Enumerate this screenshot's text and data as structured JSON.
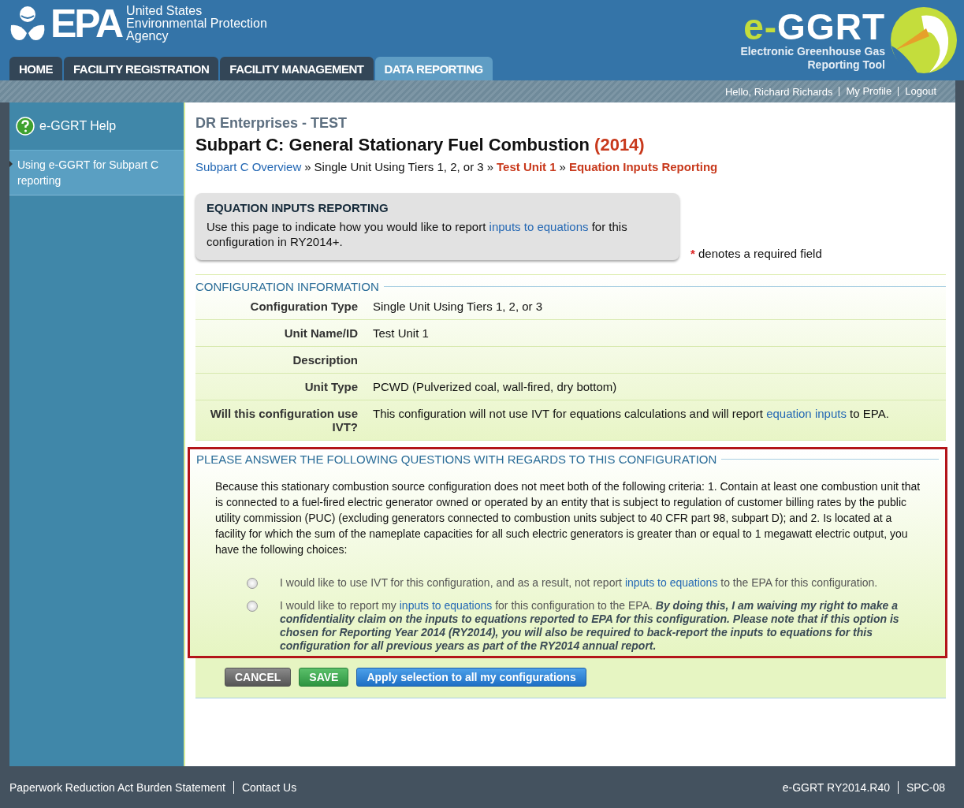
{
  "header": {
    "agency": [
      "United States",
      "Environmental Protection",
      "Agency"
    ],
    "logo_text": "EPA",
    "tool_logo": {
      "e": "e-",
      "ggrt": "GGRT",
      "subtitle": [
        "Electronic Greenhouse Gas",
        "Reporting Tool"
      ]
    }
  },
  "tabs": [
    {
      "label": "HOME",
      "selected": false
    },
    {
      "label": "FACILITY REGISTRATION",
      "selected": false
    },
    {
      "label": "FACILITY MANAGEMENT",
      "selected": false
    },
    {
      "label": "DATA REPORTING",
      "selected": true
    }
  ],
  "user_bar": {
    "greeting": "Hello, Richard Richards",
    "links": [
      "My Profile",
      "Logout"
    ]
  },
  "sidebar": {
    "title": "e-GGRT Help",
    "items": [
      {
        "label": "Using e-GGRT for Subpart C reporting",
        "selected": true
      }
    ]
  },
  "company": "DR Enterprises - TEST",
  "page_title": {
    "text": "Subpart C: General Stationary Fuel Combustion",
    "year": "(2014)"
  },
  "breadcrumb": [
    {
      "kind": "link",
      "text": "Subpart C Overview"
    },
    {
      "kind": "sep",
      "text": "»"
    },
    {
      "kind": "plain",
      "text": "Single Unit Using Tiers 1, 2, or 3"
    },
    {
      "kind": "sep",
      "text": "»"
    },
    {
      "kind": "current",
      "text": "Test Unit 1"
    },
    {
      "kind": "sep",
      "text": "»"
    },
    {
      "kind": "current",
      "text": "Equation Inputs Reporting"
    }
  ],
  "info_box": {
    "title": "EQUATION INPUTS REPORTING",
    "parts": [
      {
        "kind": "text",
        "text": "Use this page to indicate how you would like to report "
      },
      {
        "kind": "link",
        "text": "inputs to equations"
      },
      {
        "kind": "text",
        "text": " for this configuration in RY2014+."
      }
    ]
  },
  "required_note": {
    "mark": "*",
    "text": "denotes a required field"
  },
  "config_section": {
    "title": "CONFIGURATION INFORMATION",
    "rows": [
      {
        "label": "Configuration Type",
        "parts": [
          {
            "kind": "text",
            "text": "Single Unit Using Tiers 1, 2, or 3"
          }
        ]
      },
      {
        "label": "Unit Name/ID",
        "parts": [
          {
            "kind": "text",
            "text": "Test Unit 1"
          }
        ]
      },
      {
        "label": "Description",
        "parts": []
      },
      {
        "label": "Unit Type",
        "parts": [
          {
            "kind": "text",
            "text": "PCWD (Pulverized coal, wall-fired, dry bottom)"
          }
        ]
      },
      {
        "label": "Will this configuration use IVT?",
        "parts": [
          {
            "kind": "text",
            "text": "This configuration will not use IVT for equations calculations and will report "
          },
          {
            "kind": "link",
            "text": "equation inputs"
          },
          {
            "kind": "text",
            "text": " to EPA."
          }
        ]
      }
    ]
  },
  "questions_section": {
    "title": "PLEASE ANSWER THE FOLLOWING QUESTIONS WITH REGARDS TO THIS CONFIGURATION",
    "intro": "Because this stationary combustion source configuration does not meet both of the following criteria: 1. Contain at least one combustion unit that is connected to a fuel-fired electric generator owned or operated by an entity that is subject to regulation of customer billing rates by the public utility commission (PUC) (excluding generators connected to combustion units subject to 40 CFR part 98, subpart D); and 2. Is located at a facility for which the sum of the nameplate capacities for all such electric generators is greater than or equal to 1 megawatt electric output, you have the following choices:",
    "options": [
      {
        "selected": false,
        "parts": [
          {
            "kind": "text",
            "text": "I would like to use IVT for this configuration, and as a result, not report "
          },
          {
            "kind": "link",
            "text": "inputs to equations"
          },
          {
            "kind": "text",
            "text": " to the EPA for this configuration."
          }
        ]
      },
      {
        "selected": false,
        "parts": [
          {
            "kind": "text",
            "text": "I would like to report my "
          },
          {
            "kind": "link",
            "text": "inputs to equations"
          },
          {
            "kind": "text",
            "text": " for this configuration to the EPA. "
          },
          {
            "kind": "emphasis",
            "text": "By doing this, I am waiving my right to make a confidentiality claim on the inputs to equations reported to EPA for this configuration. Please note that if this option is chosen for Reporting Year 2014 (RY2014), you will also be required to back-report the inputs to equations for this configuration for all previous years as part of the RY2014 annual report."
          }
        ]
      }
    ]
  },
  "buttons": [
    {
      "kind": "cancel",
      "label": "CANCEL"
    },
    {
      "kind": "save",
      "label": "SAVE"
    },
    {
      "kind": "apply",
      "label": "Apply selection to all my configurations"
    }
  ],
  "footer": {
    "left": [
      "Paperwork Reduction Act Burden Statement",
      "Contact Us"
    ],
    "right": [
      "e-GGRT RY2014.R40",
      "SPC-08"
    ]
  }
}
